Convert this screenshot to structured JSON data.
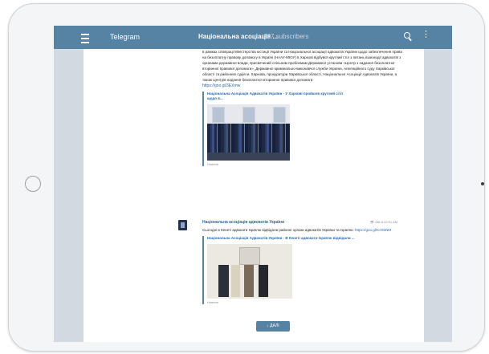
{
  "appbar": {
    "app_name": "Telegram",
    "chat_title": "Національна асоціація ...",
    "chat_subtitle": "187 subscribers",
    "icons": [
      "menu-icon",
      "search-icon",
      "more-vert-icon"
    ]
  },
  "messages": [
    {
      "body": "в рамках співпраці Міністерства юстиції України та Національної асоціації адвокатів України щодо забезпечення права на безоплатну правову допомогу в Україні (НААУ-МЮУ) в Харкові відбувся круглий стіл з питань взаємодії адвокатів з органами державної влади, присвячений спільним проблемам Державної установи «Центр з надання безоплатної вторинної правової допомоги», Державної кримінально-виконавчої служби України, Апеляційного суду Харківської області та районних судів м. Харкова, прокуратури Харківської області, Національної Асоціації Адвокатів України, а також Центрів надання безоплатної вторинної правової допомоги.",
      "link": "https://goo.gl/3EXmw",
      "preview_title": "Національна Асоціація Адвокатів України - У Харкові пройшов круглий стіл щодо в...",
      "caption": "Новини"
    },
    {
      "author": "Національна асоціація адвокатів України",
      "meta": "👁 286  8:32:51 AM",
      "body": "Сьогодні в Кенеті адвокати Ізраїлю відвідали районні органи адвокатів України та Ізраїлю:",
      "link": "https://goo.gl/CzXbNM",
      "preview_title": "Національна Асоціація Адвокатів України - В Кенеті адвокати Ізраїлю відвідали ...",
      "caption": "Новини"
    }
  ],
  "down_button": "↓ ДАЛІ"
}
